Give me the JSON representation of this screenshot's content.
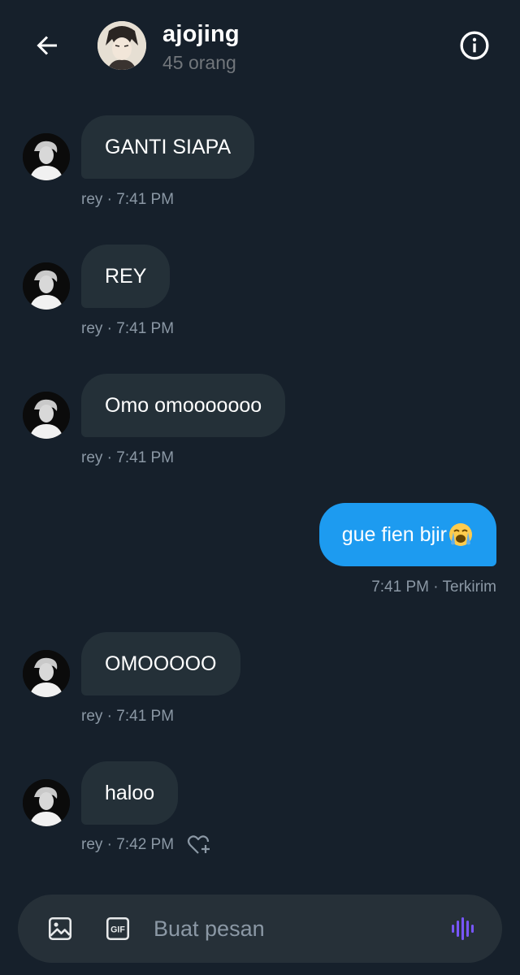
{
  "header": {
    "title": "ajojing",
    "subtitle": "45 orang",
    "back_icon": "arrow-left-icon",
    "info_icon": "info-icon"
  },
  "messages": [
    {
      "direction": "in",
      "text": "GANTI SIAPA",
      "meta": "rey · 7:41 PM"
    },
    {
      "direction": "in",
      "text": "REY",
      "meta": "rey · 7:41 PM"
    },
    {
      "direction": "in",
      "text": "Omo omooooooo",
      "meta": "rey · 7:41 PM"
    },
    {
      "direction": "out",
      "text": "gue fien bjir",
      "emoji": "loudly-crying-face",
      "meta": "7:41 PM · Terkirim"
    },
    {
      "direction": "in",
      "text": "OMOOOOO",
      "meta": "rey · 7:41 PM"
    },
    {
      "direction": "in",
      "text": "haloo",
      "meta": "rey · 7:42 PM",
      "reaction_icon": "heart-plus-icon"
    }
  ],
  "composer": {
    "placeholder": "Buat pesan",
    "image_icon": "image-icon",
    "gif_icon": "gif-icon",
    "gif_label": "GIF",
    "voice_icon": "voice-wave-icon"
  },
  "colors": {
    "background": "#16202b",
    "incoming_bubble": "#243038",
    "outgoing_bubble": "#1d9bf0",
    "meta_text": "#8b98a5",
    "voice_accent": "#7856ff"
  }
}
